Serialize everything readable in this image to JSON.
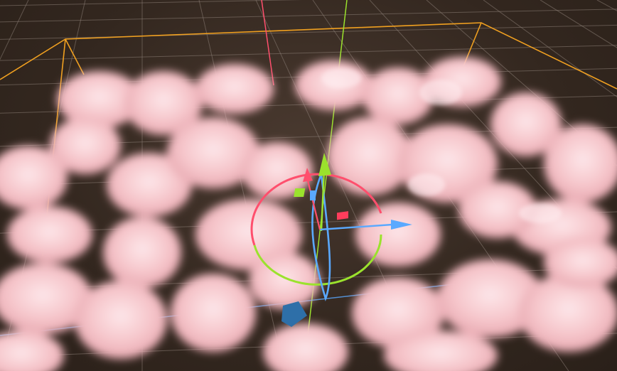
{
  "scene": {
    "view": "3d-scene-viewport",
    "selected_object": "cloud-volume",
    "gizmo": "transform-move-rotate",
    "colors": {
      "background": "#3a2f28",
      "grid": "#8a7e74",
      "bounds": "#f0a020",
      "cloud": "#f4c2c6",
      "axis_x": "#ff4f6d",
      "axis_y": "#9be22d",
      "axis_z": "#5aa9ff"
    }
  }
}
